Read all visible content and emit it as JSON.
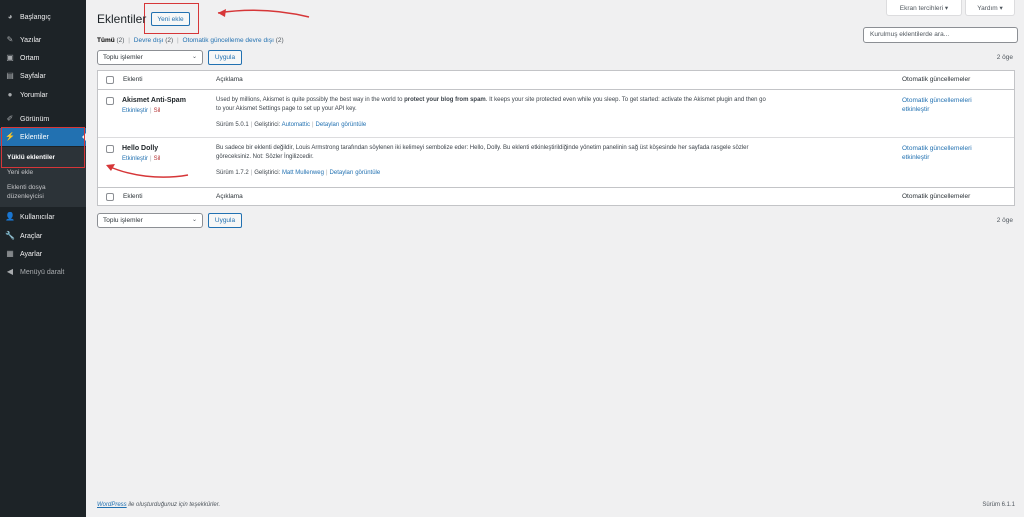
{
  "sidebar": {
    "items": [
      {
        "label": "Başlangıç",
        "icon": "dashboard-icon"
      },
      {
        "label": "Yazılar",
        "icon": "pin-icon"
      },
      {
        "label": "Ortam",
        "icon": "media-icon"
      },
      {
        "label": "Sayfalar",
        "icon": "page-icon"
      },
      {
        "label": "Yorumlar",
        "icon": "comment-icon"
      },
      {
        "label": "Görünüm",
        "icon": "brush-icon"
      },
      {
        "label": "Eklentiler",
        "icon": "plugin-icon"
      },
      {
        "label": "Kullanıcılar",
        "icon": "users-icon"
      },
      {
        "label": "Araçlar",
        "icon": "wrench-icon"
      },
      {
        "label": "Ayarlar",
        "icon": "settings-icon"
      },
      {
        "label": "Menüyü daralt",
        "icon": "collapse-icon"
      }
    ],
    "submenu": {
      "installed": "Yüklü eklentiler",
      "add_new": "Yeni ekle",
      "editor_line1": "Eklenti dosya",
      "editor_line2": "düzenleyicisi"
    }
  },
  "header": {
    "title": "Eklentiler",
    "add_new": "Yeni ekle",
    "screen_options": "Ekran tercihleri ▾",
    "help": "Yardım ▾"
  },
  "filters": {
    "all": "Tümü",
    "all_count": "(2)",
    "inactive": "Devre dışı",
    "inactive_count": "(2)",
    "autoupdate": "Otomatik güncelleme devre dışı",
    "autoupdate_count": "(2)"
  },
  "search": {
    "placeholder": "Kurulmuş eklentilerde ara..."
  },
  "bulk": {
    "select": "Toplu işlemler",
    "apply": "Uygula",
    "count": "2 öge"
  },
  "table": {
    "headers": {
      "plugin": "Eklenti",
      "description": "Açıklama",
      "auto": "Otomatik güncellemeler"
    },
    "rows": [
      {
        "name": "Akismet Anti-Spam",
        "activate": "Etkinleştir",
        "delete": "Sil",
        "desc_line1_pre": "Used by millions, Akismet is quite possibly the best way in the world to ",
        "desc_line1_bold": "protect your blog from spam",
        "desc_line1_post": ". It keeps your site protected even while you sleep. To get started: activate the Akismet plugin and then go",
        "desc_line2": "to your Akismet Settings page to set up your API key.",
        "version": "Sürüm 5.0.1",
        "by_label": "Geliştirici:",
        "author": "Automattic",
        "details": "Detayları görüntüle",
        "auto_line1": "Otomatik güncellemeleri",
        "auto_line2": "etkinleştir"
      },
      {
        "name": "Hello Dolly",
        "activate": "Etkinleştir",
        "delete": "Sil",
        "desc_line1": "Bu sadece bir eklenti değildir, Louis Armstrong tarafından söylenen iki kelimeyi sembolize eder: Hello, Dolly. Bu eklenti etkinleştirildiğinde yönetim panelinin sağ üst köşesinde her sayfada rasgele sözler",
        "desc_line2": "göreceksiniz. Not: Sözler İngilizcedir.",
        "version": "Sürüm 1.7.2",
        "by_label": "Geliştirici:",
        "author": "Matt Mullenweg",
        "details": "Detayları görüntüle",
        "auto_line1": "Otomatik güncellemeleri",
        "auto_line2": "etkinleştir"
      }
    ]
  },
  "footer": {
    "link": "WordPress",
    "text": " ile oluşturduğunuz için teşekkürler.",
    "version": "Sürüm 6.1.1"
  },
  "colors": {
    "accent": "#2271b1",
    "sidebar": "#1d2327",
    "annotation": "#d63638"
  }
}
